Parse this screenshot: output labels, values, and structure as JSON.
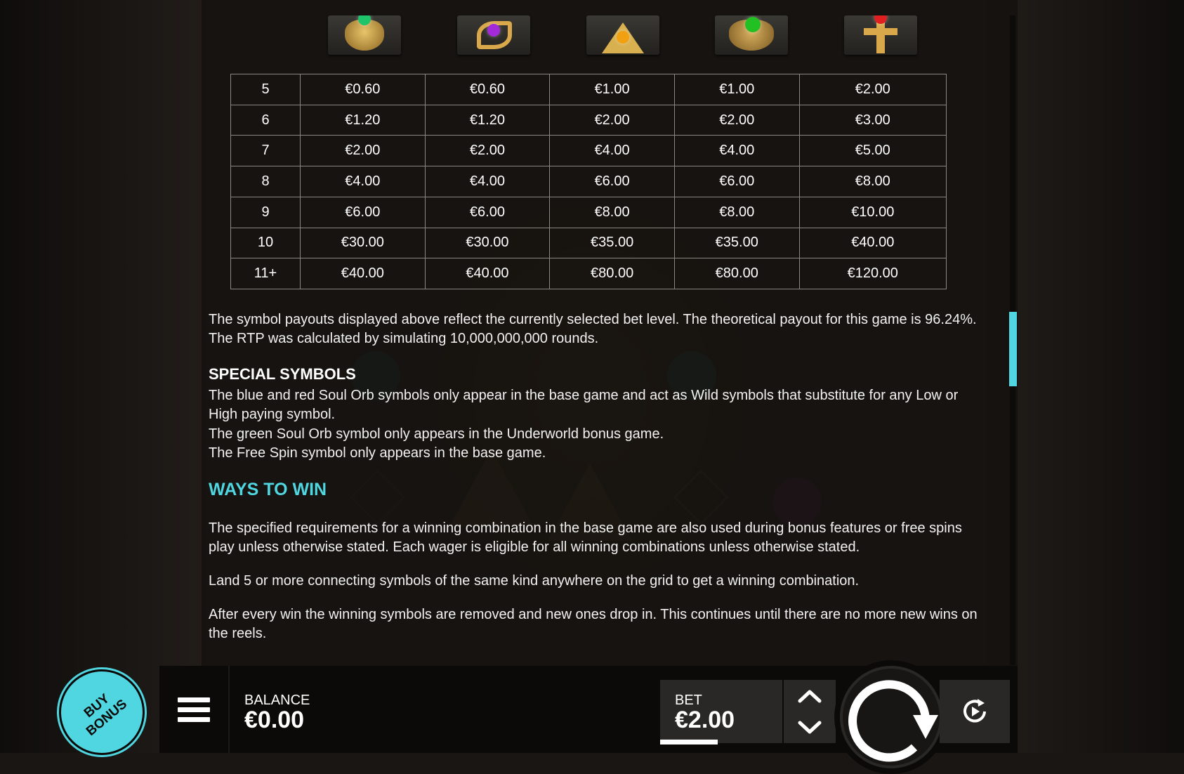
{
  "paytable": {
    "symbol_icons": [
      "scarab-green-gem-icon",
      "eye-of-horus-purple-gem-icon",
      "pyramid-amber-gem-icon",
      "scarab-wings-green-gem-icon",
      "ankh-red-gem-icon"
    ],
    "rows": [
      {
        "count": "5",
        "values": [
          "€0.60",
          "€0.60",
          "€1.00",
          "€1.00",
          "€2.00"
        ]
      },
      {
        "count": "6",
        "values": [
          "€1.20",
          "€1.20",
          "€2.00",
          "€2.00",
          "€3.00"
        ]
      },
      {
        "count": "7",
        "values": [
          "€2.00",
          "€2.00",
          "€4.00",
          "€4.00",
          "€5.00"
        ]
      },
      {
        "count": "8",
        "values": [
          "€4.00",
          "€4.00",
          "€6.00",
          "€6.00",
          "€8.00"
        ]
      },
      {
        "count": "9",
        "values": [
          "€6.00",
          "€6.00",
          "€8.00",
          "€8.00",
          "€10.00"
        ]
      },
      {
        "count": "10",
        "values": [
          "€30.00",
          "€30.00",
          "€35.00",
          "€35.00",
          "€40.00"
        ]
      },
      {
        "count": "11+",
        "values": [
          "€40.00",
          "€40.00",
          "€80.00",
          "€80.00",
          "€120.00"
        ]
      }
    ]
  },
  "text": {
    "payout_note": "The symbol payouts displayed above reflect the currently selected bet level. The theoretical payout for this game is 96.24%. The RTP was calculated by simulating 10,000,000,000 rounds.",
    "special_heading": "SPECIAL SYMBOLS",
    "special_1": "The blue and red Soul Orb symbols only appear in the base game and act as Wild symbols that substitute for any Low or High paying symbol.",
    "special_2": "The green Soul Orb symbol only appears in the Underworld bonus game.",
    "special_3": "The Free Spin symbol only appears in the base game.",
    "ways_heading": "WAYS TO WIN",
    "ways_1": "The specified requirements for a winning combination in the base game are also used during bonus features or free spins play unless otherwise stated. Each wager is eligible for all winning combinations unless otherwise stated.",
    "ways_2": "Land 5 or more connecting symbols of the same kind anywhere on the grid to get a winning combination.",
    "ways_3": "After every win the winning symbols are removed and new ones drop in. This continues until there are no more new wins on the reels."
  },
  "controls": {
    "buy_bonus_line1": "BUY",
    "buy_bonus_line2": "BONUS",
    "balance_label": "BALANCE",
    "balance_value": "€0.00",
    "bet_label": "BET",
    "bet_value": "€2.00"
  },
  "colors": {
    "accent": "#4fd6e0",
    "text": "#ffffff"
  }
}
